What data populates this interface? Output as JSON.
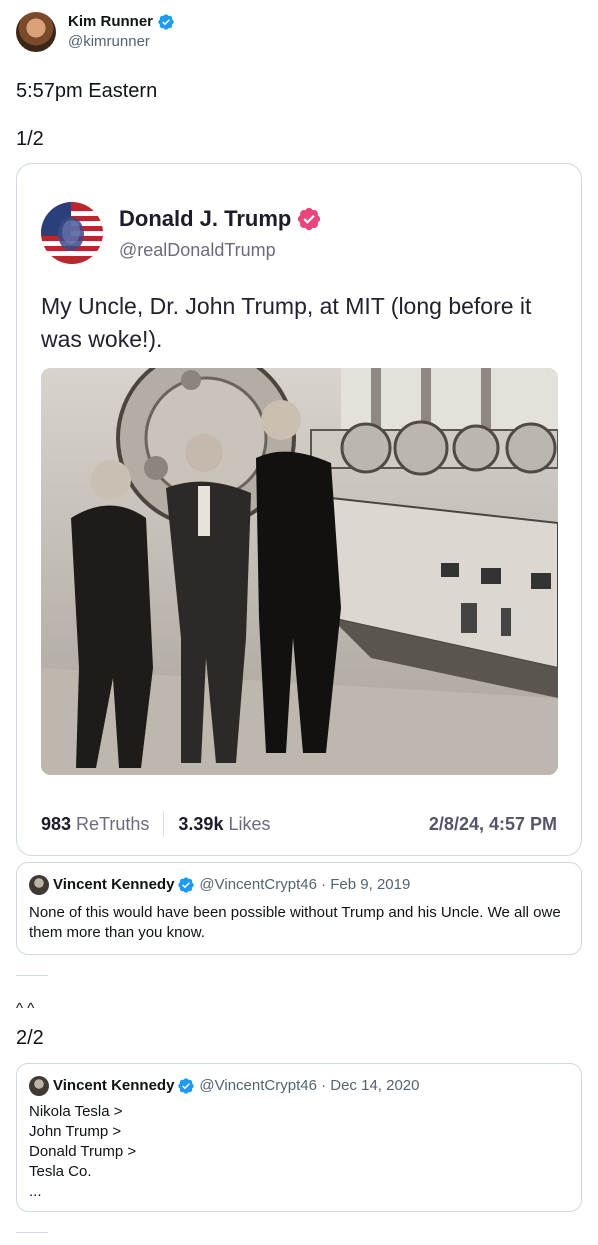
{
  "author": {
    "name": "Kim Runner",
    "handle": "@kimrunner"
  },
  "lines": {
    "time": "5:57pm Eastern",
    "part1": "1/2",
    "carets": "^ ^",
    "part2": "2/2"
  },
  "truth": {
    "name": "Donald J. Trump",
    "handle": "@realDonaldTrump",
    "text": "My Uncle, Dr. John Trump, at MIT (long before it was woke!).",
    "retruths_count": "983",
    "retruths_label": "ReTruths",
    "likes_count": "3.39k",
    "likes_label": "Likes",
    "date": "2/8/24, 4:57 PM",
    "verified_color": "#e8467c"
  },
  "quote1": {
    "name": "Vincent Kennedy",
    "meta": "@VincentCrypt46 · Feb 9, 2019",
    "body": "None of this would have been possible without Trump and his Uncle. We all owe them more than you know."
  },
  "quote2": {
    "name": "Vincent Kennedy",
    "meta": "@VincentCrypt46 · Dec 14, 2020",
    "lines": [
      "Nikola Tesla >",
      "John Trump >",
      "Donald Trump >",
      "Tesla Co.",
      "..."
    ]
  },
  "colors": {
    "verified_blue": "#1d9bf0",
    "border": "#cfd9de",
    "secondary": "#536471"
  }
}
